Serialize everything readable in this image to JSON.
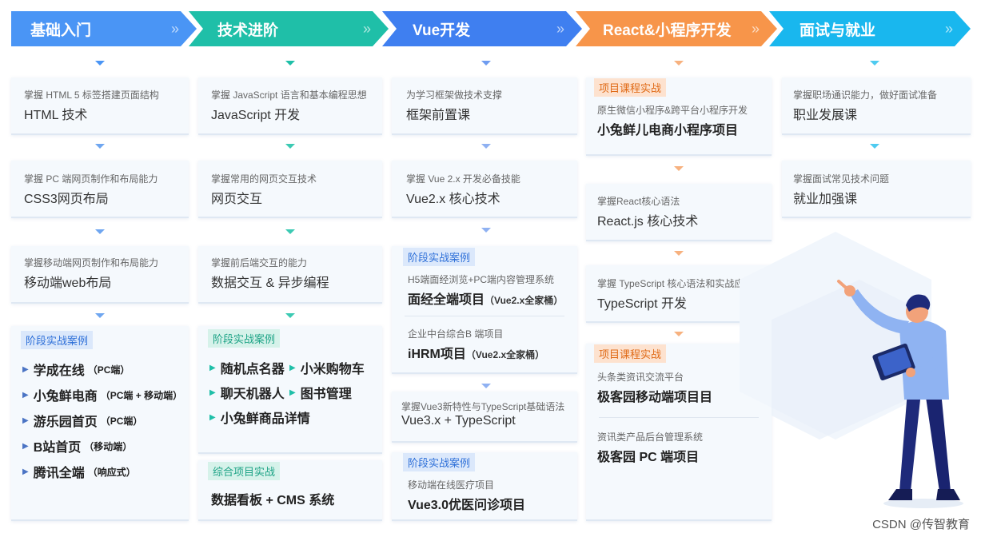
{
  "header": {
    "steps": [
      {
        "label": "基础入门",
        "color": "#4a95f5"
      },
      {
        "label": "技术进阶",
        "color": "#1fbfa8"
      },
      {
        "label": "Vue开发",
        "color": "#3f7ff0"
      },
      {
        "label": "React&小程序开发",
        "color": "#f7954a"
      },
      {
        "label": "面试与就业",
        "color": "#19b7ee"
      }
    ],
    "chevron": "»"
  },
  "col1": {
    "c1": {
      "sub": "掌握 HTML 5 标签搭建页面结构",
      "main": "HTML 技术"
    },
    "c2": {
      "sub": "掌握 PC 端网页制作和布局能力",
      "main": "CSS3网页布局"
    },
    "c3": {
      "sub": "掌握移动端网页制作和布局能力",
      "main": "移动端web布局"
    },
    "cases": {
      "tag": "阶段实战案例",
      "items": [
        {
          "name": "学成在线",
          "note": "（PC端）"
        },
        {
          "name": "小兔鲜电商",
          "note": "（PC端 + 移动端）"
        },
        {
          "name": "游乐园首页",
          "note": "（PC端）"
        },
        {
          "name": "B站首页",
          "note": "（移动端）"
        },
        {
          "name": "腾讯全端",
          "note": "（响应式）"
        }
      ]
    }
  },
  "col2": {
    "c1": {
      "sub": "掌握 JavaScript 语言和基本编程思想",
      "main": "JavaScript 开发"
    },
    "c2": {
      "sub": "掌握常用的网页交互技术",
      "main": "网页交互"
    },
    "c3": {
      "sub": "掌握前后端交互的能力",
      "main": "数据交互 & 异步编程"
    },
    "cases": {
      "tag": "阶段实战案例",
      "items": [
        "随机点名器",
        "小米购物车",
        "聊天机器人",
        "图书管理",
        "小兔鲜商品详情"
      ]
    },
    "project": {
      "tag": "综合项目实战",
      "main": "数据看板 + CMS 系统"
    }
  },
  "col3": {
    "c1": {
      "sub": "为学习框架做技术支撑",
      "main": "框架前置课"
    },
    "c2": {
      "sub": "掌握 Vue 2.x 开发必备技能",
      "main": "Vue2.x 核心技术"
    },
    "cases": {
      "tag": "阶段实战案例",
      "p1_sub": "H5端面经浏览+PC端内容管理系统",
      "p1_main": "面经全端项目",
      "p1_note": "（Vue2.x全家桶）",
      "p2_sub": "企业中台综合B 端项目",
      "p2_main": "iHRM项目",
      "p2_note": "（Vue2.x全家桶）"
    },
    "c3": {
      "sub": "掌握Vue3新特性与TypeScript基础语法",
      "main": "Vue3.x + TypeScript"
    },
    "cases2": {
      "tag": "阶段实战案例",
      "sub": "移动端在线医疗项目",
      "main": "Vue3.0优医问诊项目"
    }
  },
  "col4": {
    "p1": {
      "tag": "项目课程实战",
      "sub": "原生微信小程序&跨平台小程序开发",
      "main": "小兔鲜儿电商小程序项目"
    },
    "c2": {
      "sub": "掌握React核心语法",
      "main": "React.js 核心技术"
    },
    "c3": {
      "sub": "掌握 TypeScript 核心语法和实战应用",
      "main": "TypeScript 开发"
    },
    "p2": {
      "tag": "项目课程实战",
      "sub1": "头条类资讯交流平台",
      "main1": "极客园移动端项目目",
      "sub2": "资讯类产品后台管理系统",
      "main2": "极客园 PC 端项目"
    }
  },
  "col5": {
    "c1": {
      "sub": "掌握职场通识能力，做好面试准备",
      "main": "职业发展课"
    },
    "c2": {
      "sub": "掌握面试常见技术问题",
      "main": "就业加强课"
    }
  },
  "watermark": "CSDN @传智教育"
}
